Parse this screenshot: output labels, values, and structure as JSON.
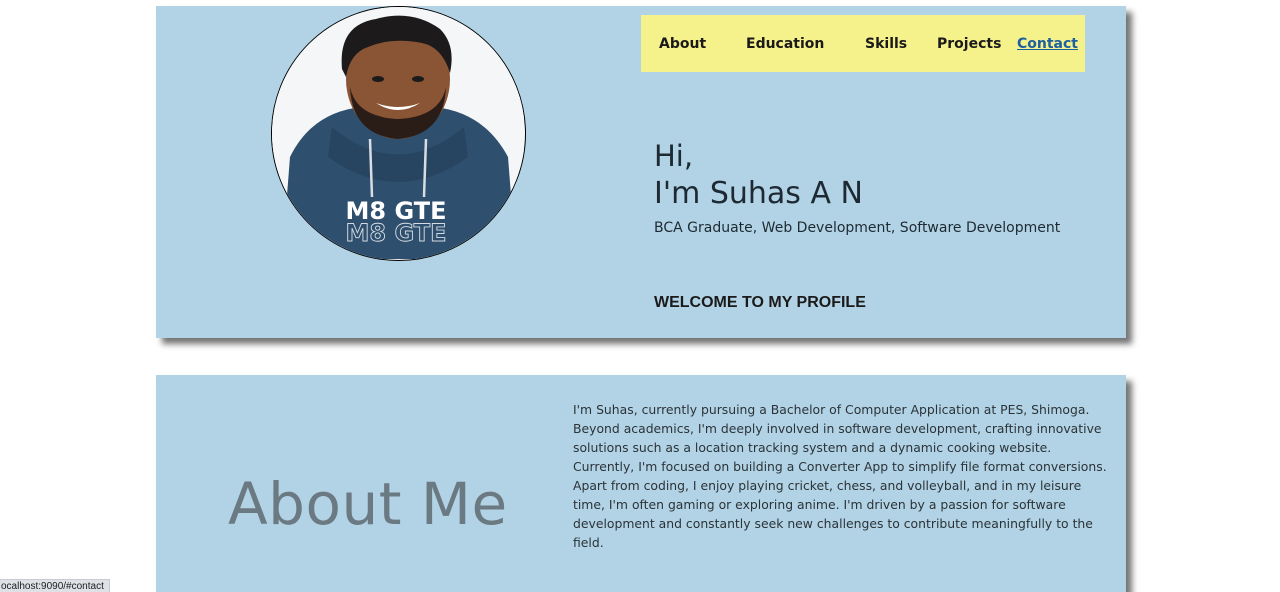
{
  "nav": {
    "items": [
      {
        "label": "About"
      },
      {
        "label": "Education"
      },
      {
        "label": "Skills"
      },
      {
        "label": "Projects"
      },
      {
        "label": "Contact"
      }
    ]
  },
  "hero": {
    "greeting": "Hi,",
    "name": "I'm Suhas A N",
    "subtitle": "BCA Graduate, Web Development, Software Development",
    "welcome": "WELCOME TO MY PROFILE",
    "avatar_shirt_text": "M8 GTE"
  },
  "about": {
    "title": "About Me",
    "text": "I'm Suhas, currently pursuing a Bachelor of Computer Application at PES, Shimoga. Beyond academics, I'm deeply involved in software development, crafting innovative solutions such as a location tracking system and a dynamic cooking website. Currently, I'm focused on building a Converter App to simplify file format conversions. Apart from coding, I enjoy playing cricket, chess, and volleyball, and in my leisure time, I'm often gaming or exploring anime. I'm driven by a passion for software development and constantly seek new challenges to contribute meaningfully to the field."
  },
  "status_bar": {
    "url": "ocalhost:9090/#contact"
  },
  "colors": {
    "panel": "#b2d3e5",
    "nav_bg": "#f6f28b",
    "active_link": "#1d5fa3",
    "about_title": "#6b7a82"
  }
}
